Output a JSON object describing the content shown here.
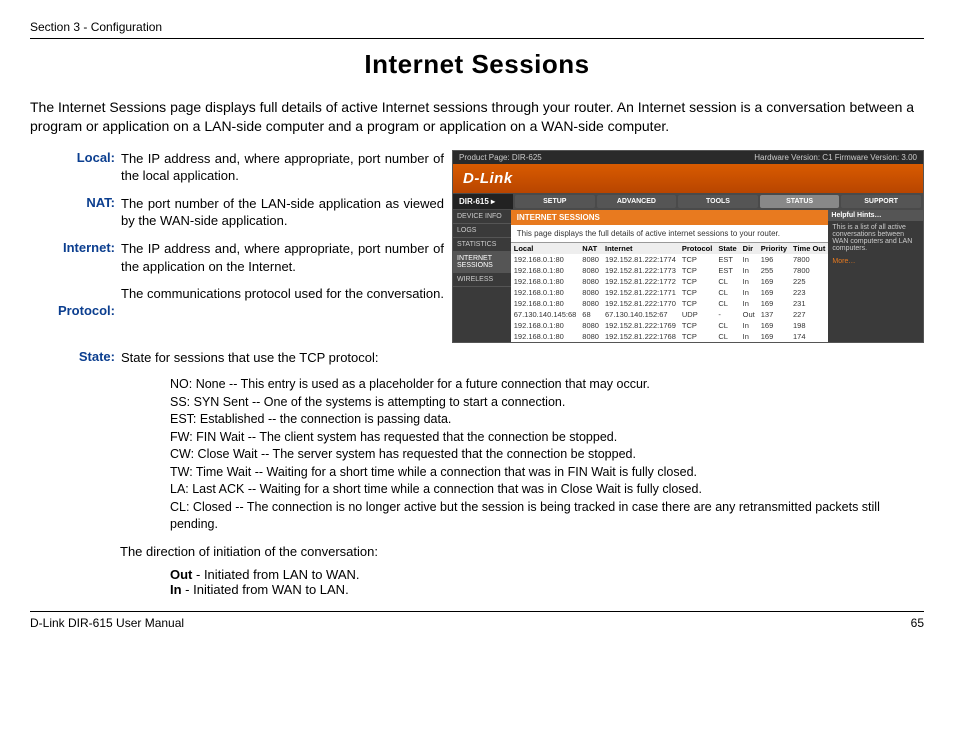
{
  "header": {
    "section": "Section 3 - Configuration"
  },
  "title": "Internet Sessions",
  "intro": "The Internet Sessions page displays full details of active Internet sessions through your router. An Internet session is a conversation between a program or application on a LAN-side computer and a program or application on a WAN-side computer.",
  "defs": {
    "local": {
      "label": "Local:",
      "text": "The IP address and, where appropriate, port number of the local application."
    },
    "nat": {
      "label": "NAT:",
      "text": "The port number of the LAN-side application as viewed by the WAN-side application."
    },
    "internet": {
      "label": "Internet:",
      "text": "The IP address and, where appropriate, port number of the application on the Internet."
    },
    "protocol": {
      "label": "Protocol:",
      "text": "The communications protocol used for the conversation."
    },
    "state": {
      "label": "State:",
      "text": "State for sessions that use the TCP protocol:"
    }
  },
  "states": {
    "no": "NO: None -- This entry is used as a placeholder for a future connection that may occur.",
    "ss": "SS: SYN Sent -- One of the systems is attempting to start a connection.",
    "est": "EST: Established -- the connection is passing data.",
    "fw": "FW: FIN Wait -- The client system has requested that the connection be stopped.",
    "cw": "CW: Close Wait -- The server system has requested that the connection be stopped.",
    "tw": "TW: Time Wait -- Waiting for a short time while a connection that was in FIN Wait is fully closed.",
    "la": "LA: Last ACK -- Waiting for a short time while a connection that was in Close Wait is fully closed.",
    "cl": "CL: Closed -- The connection is no longer active but the session is being tracked in case there are any retransmitted packets still pending."
  },
  "direction": {
    "intro": "The direction of initiation of the conversation:",
    "out_b": "Out",
    "out_t": " - Initiated from LAN to WAN.",
    "in_b": "In",
    "in_t": " - Initiated from WAN to LAN."
  },
  "footer": {
    "left": "D-Link DIR-615 User Manual",
    "right": "65"
  },
  "ss": {
    "top_left": "Product Page: DIR-625",
    "top_right": "Hardware Version: C1   Firmware Version: 3.00",
    "brand": "D-Link",
    "model": "DIR-615",
    "nav": {
      "setup": "SETUP",
      "advanced": "ADVANCED",
      "tools": "TOOLS",
      "status": "STATUS",
      "support": "SUPPORT"
    },
    "side": {
      "device": "DEVICE INFO",
      "logs": "LOGS",
      "stats": "STATISTICS",
      "sessions": "INTERNET SESSIONS",
      "wireless": "WIRELESS"
    },
    "main_hdr": "INTERNET SESSIONS",
    "main_sub": "This page displays the full details of active internet sessions to your router.",
    "th": {
      "local": "Local",
      "nat": "NAT",
      "internet": "Internet",
      "protocol": "Protocol",
      "state": "State",
      "dir": "Dir",
      "priority": "Priority",
      "timeout": "Time Out"
    },
    "rows": [
      [
        "192.168.0.1:80",
        "8080",
        "192.152.81.222:1774",
        "TCP",
        "EST",
        "In",
        "196",
        "7800"
      ],
      [
        "192.168.0.1:80",
        "8080",
        "192.152.81.222:1773",
        "TCP",
        "EST",
        "In",
        "255",
        "7800"
      ],
      [
        "192.168.0.1:80",
        "8080",
        "192.152.81.222:1772",
        "TCP",
        "CL",
        "In",
        "169",
        "225"
      ],
      [
        "192.168.0.1:80",
        "8080",
        "192.152.81.222:1771",
        "TCP",
        "CL",
        "In",
        "169",
        "223"
      ],
      [
        "192.168.0.1:80",
        "8080",
        "192.152.81.222:1770",
        "TCP",
        "CL",
        "In",
        "169",
        "231"
      ],
      [
        "67.130.140.145:68",
        "68",
        "67.130.140.152:67",
        "UDP",
        "-",
        "Out",
        "137",
        "227"
      ],
      [
        "192.168.0.1:80",
        "8080",
        "192.152.81.222:1769",
        "TCP",
        "CL",
        "In",
        "169",
        "198"
      ],
      [
        "192.168.0.1:80",
        "8080",
        "192.152.81.222:1768",
        "TCP",
        "CL",
        "In",
        "169",
        "174"
      ]
    ],
    "hints": {
      "title": "Helpful Hints…",
      "body": "This is a list of all active conversations between WAN computers and LAN computers.",
      "more": "More…"
    }
  }
}
